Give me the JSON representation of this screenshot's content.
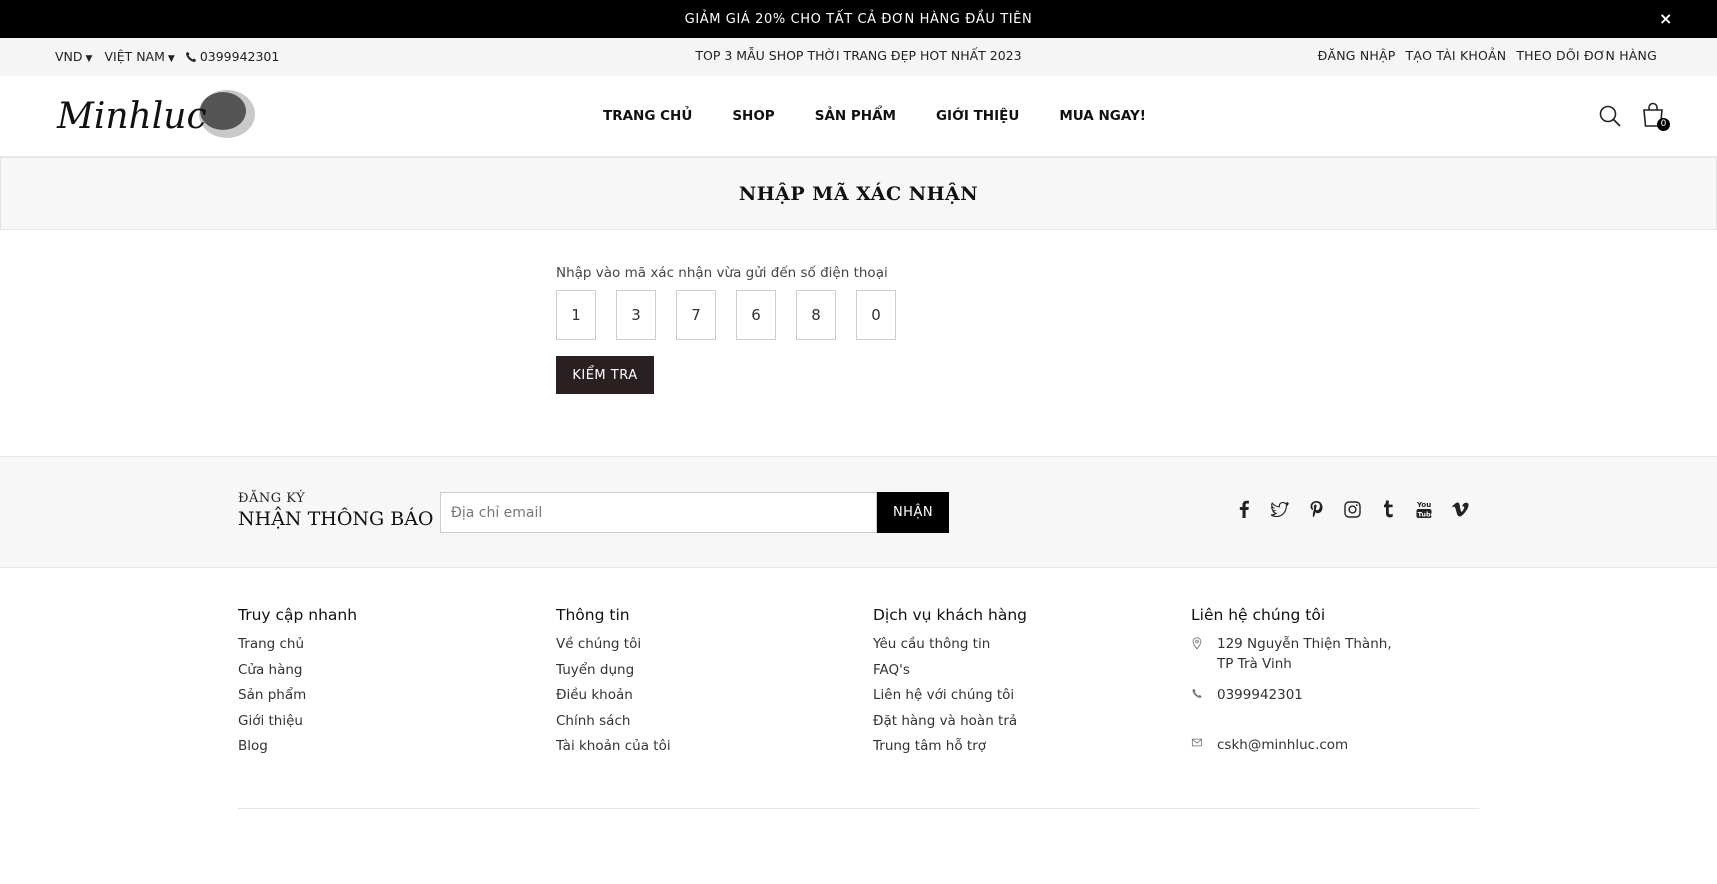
{
  "promo": {
    "text": "GIẢM GIÁ 20% CHO TẤT CẢ ĐƠN HÀNG ĐẦU TIÊN",
    "close": "×"
  },
  "topbar": {
    "currency": "VND",
    "country": "VIỆT NAM",
    "phone": "0399942301",
    "center_text": "TOP 3 MẪU SHOP THỜI TRANG ĐẸP HOT NHẤT 2023",
    "login": "ĐĂNG NHẬP",
    "register": "TẠO TÀI KHOẢN",
    "track_order": "THEO DÕI ĐƠN HÀNG"
  },
  "header": {
    "logo_text": "Minhluc",
    "nav": [
      "TRANG CHỦ",
      "SHOP",
      "SẢN PHẨM",
      "GIỚI THIỆU",
      "MUA NGAY!"
    ],
    "cart_count": "0"
  },
  "page": {
    "title": "NHẬP MÃ XÁC NHẬN",
    "hint": "Nhập vào mã xác nhận vừa gửi đến số điện thoại",
    "code_digits": [
      "1",
      "3",
      "7",
      "6",
      "8",
      "0"
    ],
    "check_button": "KIỂM TRA"
  },
  "newsletter": {
    "small_title": "ĐĂNG KÝ",
    "big_title": "NHẬN THÔNG BÁO",
    "placeholder": "Địa chỉ email",
    "button": "NHẬN",
    "socials": [
      "facebook-icon",
      "twitter-icon",
      "pinterest-icon",
      "instagram-icon",
      "tumblr-icon",
      "youtube-icon",
      "vimeo-icon"
    ]
  },
  "footer": {
    "quick_access": {
      "title": "Truy cập nhanh",
      "links": [
        "Trang chủ",
        "Cửa hàng",
        "Sản phẩm",
        "Giới thiệu",
        "Blog"
      ]
    },
    "info": {
      "title": "Thông tin",
      "links": [
        "Về chúng tôi",
        "Tuyển dụng",
        "Điều khoản",
        "Chính sách",
        "Tài khoản của tôi"
      ]
    },
    "service": {
      "title": "Dịch vụ khách hàng",
      "links": [
        "Yêu cầu thông tin",
        "FAQ's",
        "Liên hệ với chúng tôi",
        "Đặt hàng và hoàn trả",
        "Trung tâm hỗ trợ"
      ]
    },
    "contact": {
      "title": "Liên hệ chúng tôi",
      "address_line1": "129 Nguyễn Thiện Thành,",
      "address_line2": "TP Trà Vinh",
      "phone": "0399942301",
      "email": "cskh@minhluc.com"
    }
  }
}
